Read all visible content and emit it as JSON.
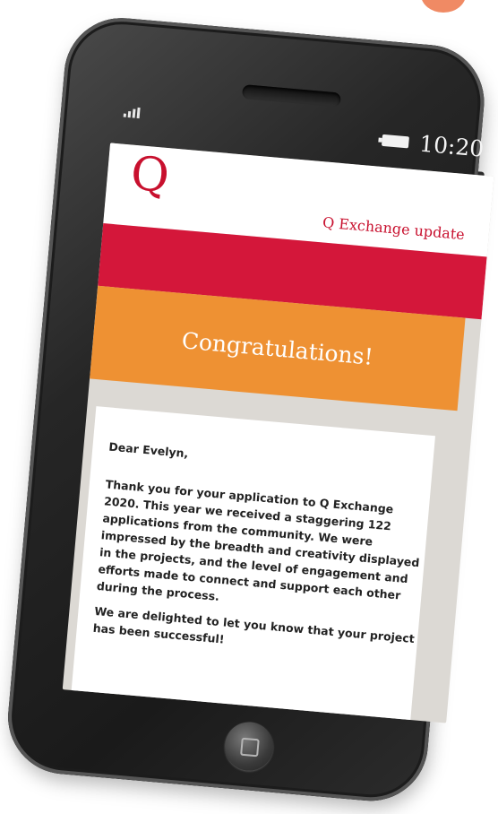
{
  "status_bar": {
    "time": "10:20",
    "icons": [
      "signal-icon",
      "battery-icon"
    ]
  },
  "email": {
    "logo": "Q",
    "update_label": "Q Exchange update",
    "banner_heading": "Congratulations!",
    "salutation": "Dear Evelyn,",
    "paragraph_1": "Thank you for your application to Q Exchange 2020. This year we received a staggering 122 applications from the community. We were impressed by the breadth and creativity displayed in the projects, and the level of engagement and efforts made to connect and support each other during the process.",
    "paragraph_2": "We are delighted to let you know that your project has been successful!"
  },
  "colors": {
    "brand_red": "#d4173a",
    "logo_red": "#c8102e",
    "accent_orange": "#ee9133",
    "background_grey": "#dcd9d4",
    "corner_dot": "#f08a64"
  }
}
